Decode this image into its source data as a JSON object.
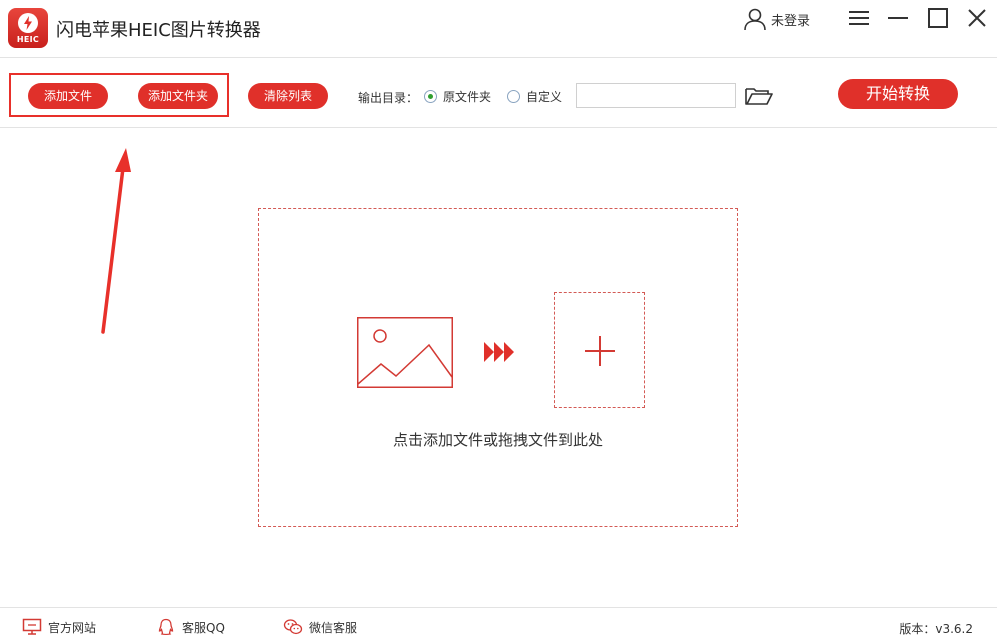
{
  "app": {
    "title": "闪电苹果HEIC图片转换器",
    "logo_text": "HEIC"
  },
  "user": {
    "label": "未登录"
  },
  "toolbar": {
    "add_file": "添加文件",
    "add_folder": "添加文件夹",
    "clear_list": "清除列表",
    "output_label": "输出目录：",
    "radio_original": "原文件夹",
    "radio_custom": "自定义",
    "selected_output": "原文件夹",
    "path_value": "",
    "start": "开始转换"
  },
  "drop_zone": {
    "hint": "点击添加文件或拖拽文件到此处"
  },
  "status": {
    "site": "官方网站",
    "qq": "客服QQ",
    "wechat": "微信客服",
    "version": "版本：v3.6.2"
  },
  "colors": {
    "accent": "#e0302a",
    "annotation": "#e8302a",
    "radio_selected": "#2f9e2f"
  },
  "icons": [
    "app-logo-icon",
    "user-icon",
    "menu-icon",
    "minimize-icon",
    "maximize-icon",
    "close-icon",
    "folder-open-icon",
    "image-icon",
    "triple-arrow-icon",
    "plus-icon",
    "monitor-icon",
    "qq-icon",
    "wechat-icon"
  ]
}
